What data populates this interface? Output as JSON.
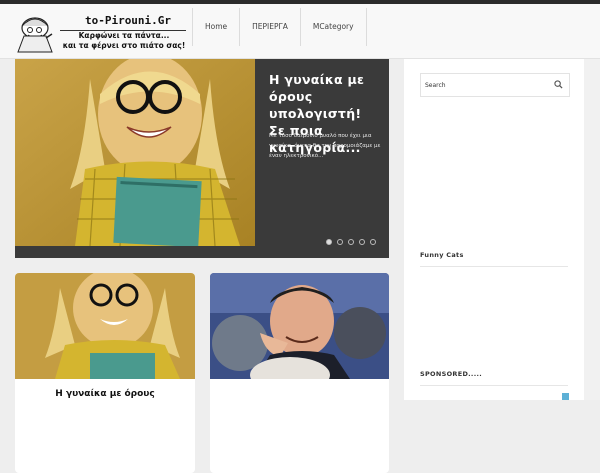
{
  "site": {
    "name": "to-Pirouni.Gr",
    "tagline_line1": "Καρφώνει τα πάντα...",
    "tagline_line2": "και τα φέρνει στο πιάτο σας!"
  },
  "nav": {
    "items": [
      "Home",
      "ΠΕΡΙΕΡΓΑ",
      "MCategory"
    ]
  },
  "slider": {
    "title": "Η γυναίκα με όρους υπολογιστή! Σε ποια κατηγορία...",
    "excerpt": "Με τόσο δαιμόνιο μυαλό που έχει μια γυναίκα, άνετα θα την παρομοιάζαμε με έναν ηλεκτρονικό...",
    "dots_total": 5,
    "active_dot": 1
  },
  "cards": [
    {
      "title": "Η γυναίκα με όρους"
    },
    {
      "title": ""
    }
  ],
  "sidebar": {
    "search_placeholder": "Search",
    "widget1_title": "Funny Cats",
    "widget2_title": "SPONSORED....."
  },
  "colors": {
    "topbar": "#2b2b2b",
    "slider_bg": "#3a3a3a",
    "page_bg": "#eeeeee"
  }
}
